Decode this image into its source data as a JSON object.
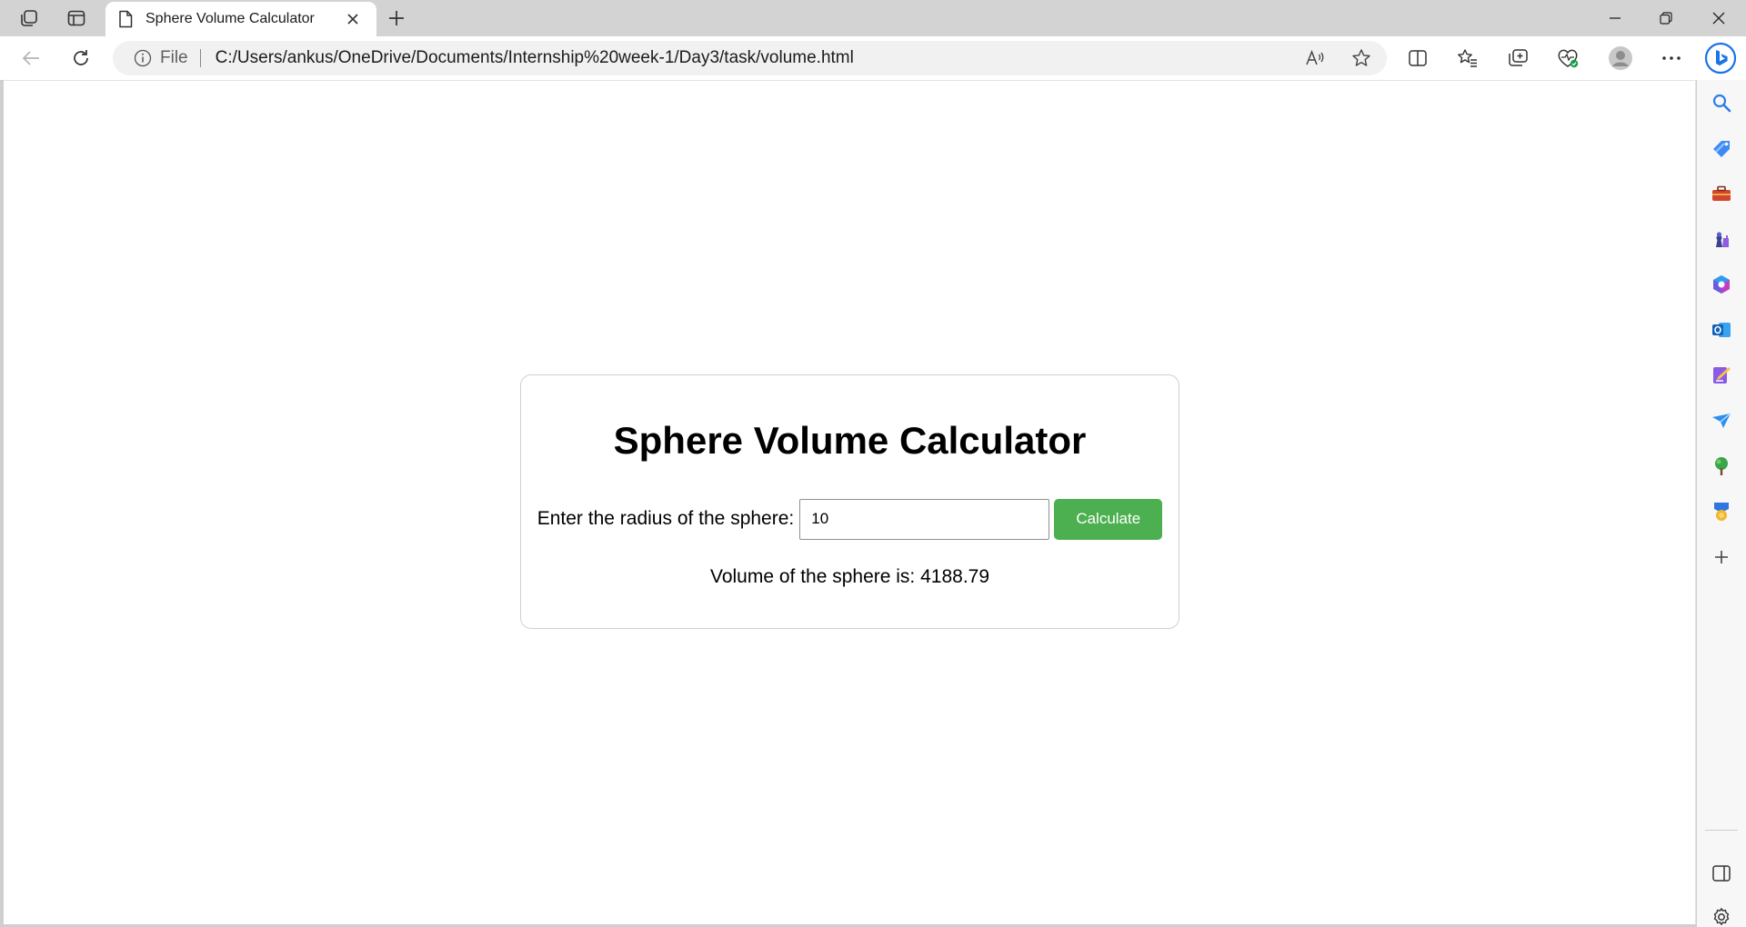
{
  "browser": {
    "tab": {
      "title": "Sphere Volume Calculator"
    },
    "address_bar": {
      "scheme_label": "File",
      "url": "C:/Users/ankus/OneDrive/Documents/Internship%20week-1/Day3/task/volume.html"
    },
    "toolbar_icons": [
      "read-aloud-icon",
      "favorite-star-icon",
      "split-screen-icon",
      "favorites-icon",
      "collections-icon",
      "browser-essentials-icon",
      "profile-avatar",
      "more-menu-icon",
      "copilot-icon"
    ],
    "sidebar_icons": [
      "search-icon",
      "shopping-icon",
      "tools-icon",
      "games-icon",
      "microsoft-365-icon",
      "outlook-icon",
      "designer-icon",
      "drop-icon",
      "tree-icon",
      "rewards-icon",
      "add-icon",
      "sidebar-toggle-icon",
      "settings-icon"
    ]
  },
  "page": {
    "title": "Sphere Volume Calculator",
    "radius_label": "Enter the radius of the sphere:",
    "radius_value": "10",
    "calculate_label": "Calculate",
    "result_text": "Volume of the sphere is: 4188.79"
  },
  "colors": {
    "button_green": "#4caf50",
    "copilot_blue": "#1a73e8"
  }
}
